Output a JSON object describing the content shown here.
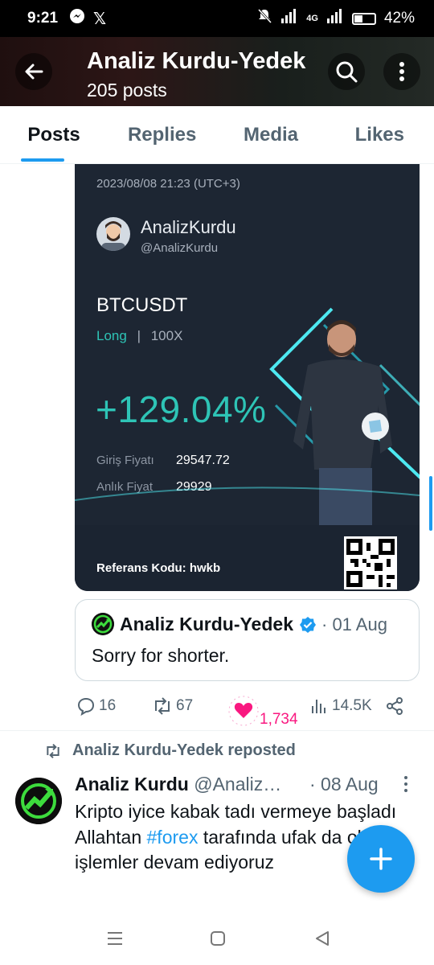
{
  "status_bar": {
    "time": "9:21",
    "network": "4G",
    "battery": "42%"
  },
  "header": {
    "title": "Analiz Kurdu-Yedek",
    "posts_count": "205 posts"
  },
  "tabs": [
    {
      "label": "Posts",
      "active": true
    },
    {
      "label": "Replies",
      "active": false
    },
    {
      "label": "Media",
      "active": false
    },
    {
      "label": "Likes",
      "active": false
    }
  ],
  "trade_card": {
    "date": "2023/08/08 21:23 (UTC+3)",
    "name": "AnalizKurdu",
    "handle": "@AnalizKurdu",
    "pair": "BTCUSDT",
    "side": "Long",
    "leverage": "100X",
    "pnl": "+129.04%",
    "entry_label": "Giriş Fiyatı",
    "entry_value": "29547.72",
    "mark_label": "Anlık Fiyat",
    "mark_value": "29929",
    "referral": "Referans Kodu: hwkb"
  },
  "quote": {
    "name": "Analiz Kurdu-Yedek",
    "date": "· 01 Aug",
    "text": "Sorry for shorter."
  },
  "actions": {
    "replies": "16",
    "reposts": "67",
    "likes": "1,734",
    "views": "14.5K"
  },
  "second_post": {
    "repost_label": "Analiz Kurdu-Yedek reposted",
    "name": "Analiz Kurdu",
    "handle": "@AnalizKurdu",
    "date": "· 08 Aug",
    "text_before": "Kripto iyice kabak tadı vermeye başladı Allahtan ",
    "hashtag": "#forex",
    "text_after": " tarafında ufak da olsa işlemler devam ediyoruz"
  },
  "colors": {
    "accent": "#1d9bf0",
    "like": "#f91880",
    "long": "#2ec4b6"
  }
}
